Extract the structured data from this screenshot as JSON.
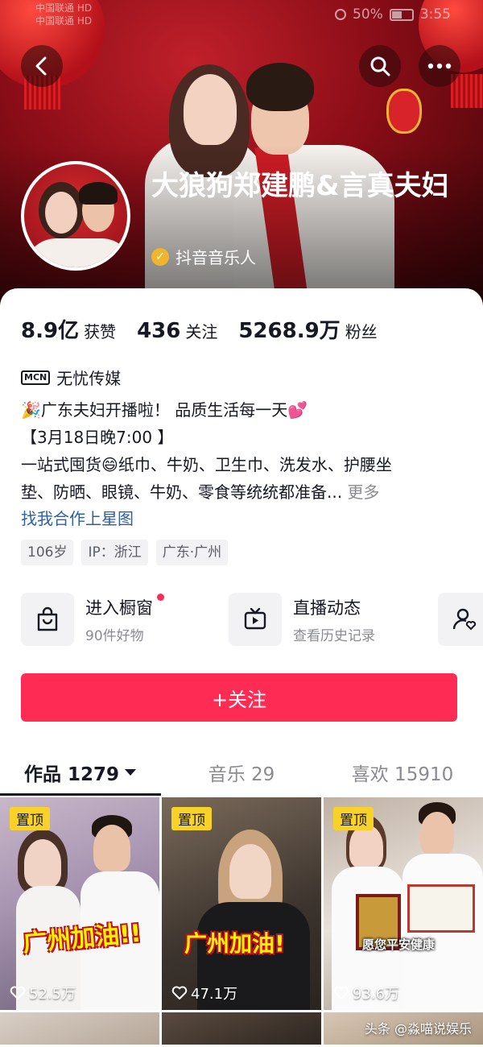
{
  "status_bar": {
    "carrier_1": "中国联通 HD",
    "carrier_2": "中国联通 HD",
    "battery": "50%",
    "time": "3:55",
    "battery_level": 0.5
  },
  "header": {
    "back_icon": "back-arrow-icon",
    "search_icon": "search-icon",
    "more_icon": "more-dots-icon"
  },
  "profile": {
    "name": "大狼狗郑建鹏&言真夫妇",
    "verified_label": "抖音音乐人",
    "stats": [
      {
        "value": "8.9亿",
        "label": "获赞"
      },
      {
        "value": "436",
        "label": "关注"
      },
      {
        "value": "5268.9万",
        "label": "粉丝"
      }
    ],
    "mcn_icon_text": "MCN",
    "mcn_name": "无忧传媒",
    "bio_lines": [
      "🎉广东夫妇开播啦！ 品质生活每一天💕",
      "【3月18日晚7:00 】",
      "一站式囤货😄纸巾、牛奶、卫生巾、洗发水、护腰坐",
      "垫、防晒、眼镜、牛奶、零食等统统都准备..."
    ],
    "bio_more": "更多",
    "bio_link": "找我合作上星图",
    "tags": [
      "106岁",
      "IP：浙江",
      "广东·广州"
    ]
  },
  "services": [
    {
      "title": "进入橱窗",
      "subtitle": "90件好物",
      "icon": "shopping-bag-icon",
      "has_dot": true
    },
    {
      "title": "直播动态",
      "subtitle": "查看历史记录",
      "icon": "tv-icon",
      "has_dot": false
    },
    {
      "icon": "user-heart-icon"
    }
  ],
  "follow_button": "+关注",
  "tabs": [
    {
      "label": "作品 1279",
      "active": true
    },
    {
      "label": "音乐 29",
      "active": false
    },
    {
      "label": "喜欢 15910",
      "active": false
    }
  ],
  "videos": [
    {
      "pinned": "置顶",
      "caption": "广州加油!!",
      "likes": "52.5万"
    },
    {
      "pinned": "置顶",
      "caption": "广州加油!",
      "likes": "47.1万"
    },
    {
      "pinned": "置顶",
      "caption": "愿您平安健康",
      "likes": "93.6万"
    }
  ],
  "watermark": "头条 @淼喵说娱乐",
  "colors": {
    "accent": "#fe2c55",
    "pin_badge": "#f8d129",
    "link": "#2e5fa1",
    "verify_badge": "#f0b52c"
  }
}
